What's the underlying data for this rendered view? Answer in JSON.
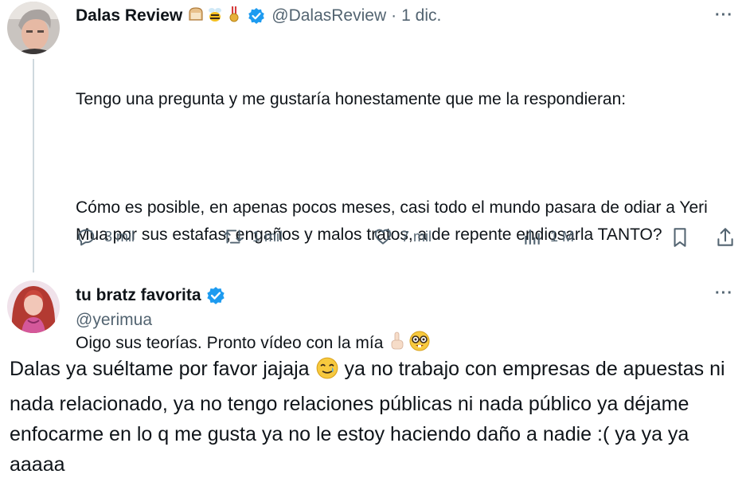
{
  "tweet": {
    "author_name": "Dalas Review",
    "handle": "@DalasReview",
    "date_separator": "·",
    "date": "1 dic.",
    "more_label": "···",
    "badges": [
      "bread-emoji",
      "bee-emoji",
      "medal-emoji"
    ],
    "paragraphs": [
      "Tengo una pregunta y me gustaría honestamente que me la respondieran:",
      "Cómo es posible, en apenas pocos meses, casi todo el mundo pasara de odiar a Yeri Mua por sus estafas, engaños y malos tratos, a de repente endiosarla TANTO?",
      "Oigo sus teorías. Pronto vídeo con la mía"
    ],
    "paragraph_end_emojis": [
      "pointing-up-emoji",
      "nerd-face-emoji"
    ],
    "metrics": {
      "replies": "3 mil",
      "reposts": "1 mil",
      "likes": "7 mil",
      "views": "1 M"
    }
  },
  "reply": {
    "author_name": "tu bratz favorita",
    "handle": "@yerimua",
    "more_label": "···",
    "text_part1": "Dalas ya suéltame por favor jajaja",
    "inline_emoji": "tear-smile-emoji",
    "text_part2": " ya no trabajo con empresas de apuestas ni nada relacionado, ya no tengo relaciones públicas ni nada público ya déjame enfocarme en lo q me gusta ya no le estoy haciendo daño a nadie :( ya ya ya aaaaa"
  },
  "colors": {
    "text": "#0f1419",
    "secondary": "#536471",
    "verified": "#1d9bf0",
    "thread_line": "#cfd9de"
  }
}
